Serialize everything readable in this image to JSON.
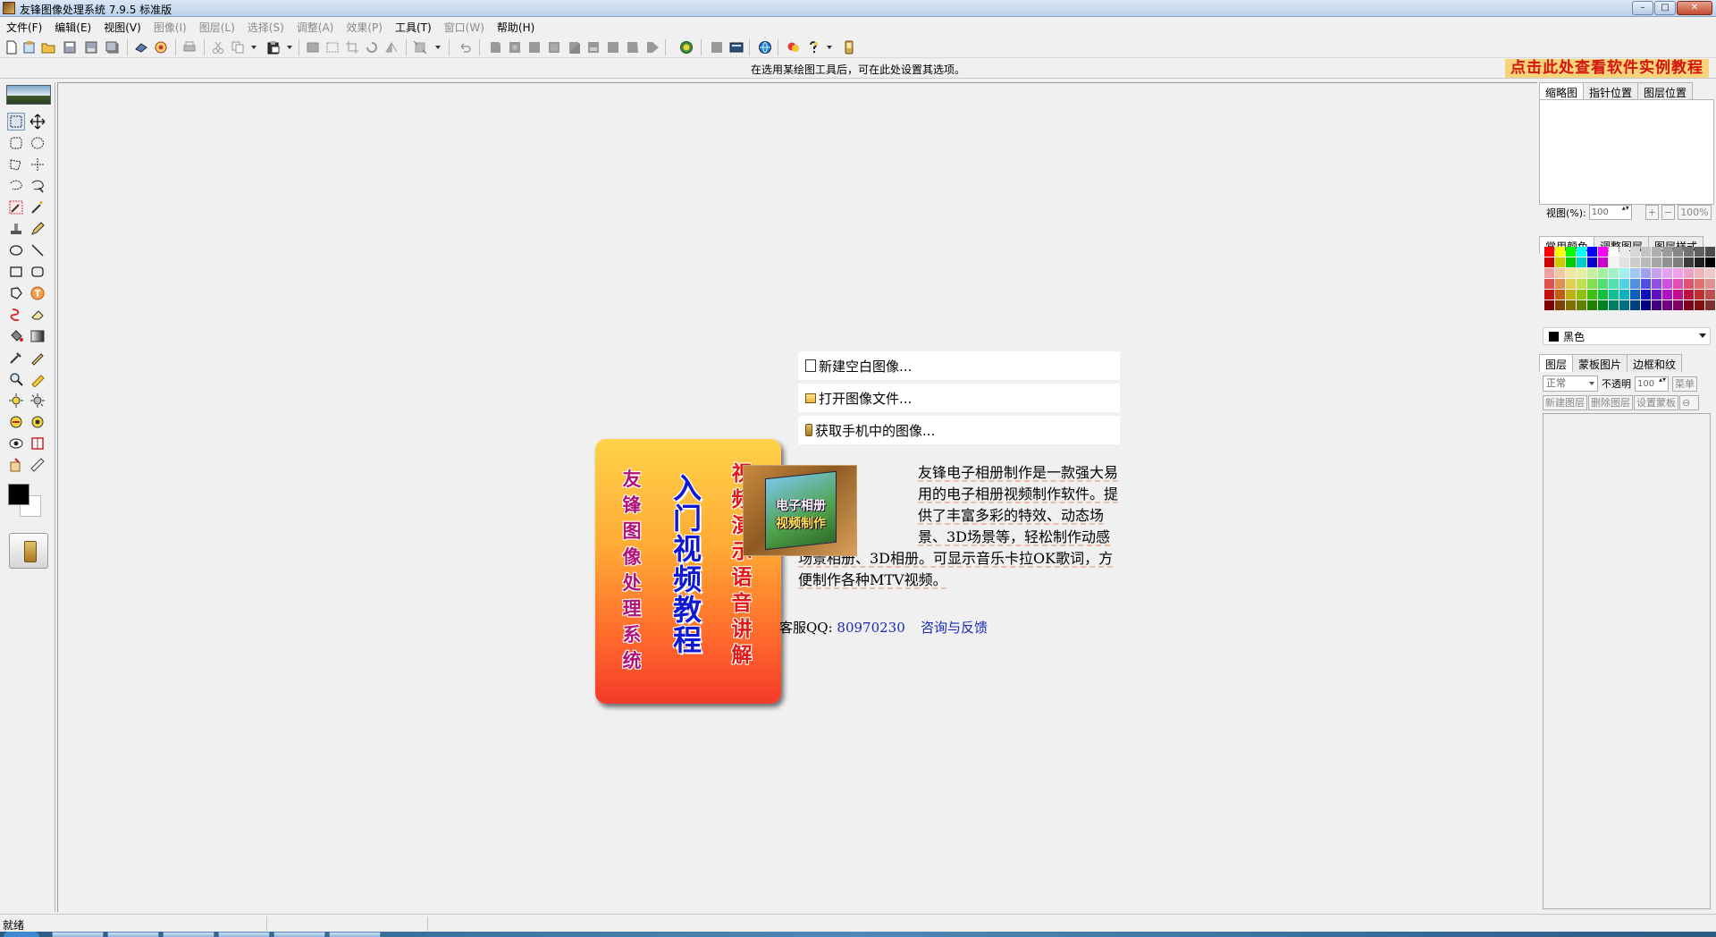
{
  "window": {
    "title": "友锋图像处理系统 7.9.5 标准版",
    "controls": {
      "minimize": "–",
      "maximize": "□",
      "close": "✕"
    }
  },
  "menu": [
    {
      "label": "文件(F)",
      "enabled": true
    },
    {
      "label": "编辑(E)",
      "enabled": true
    },
    {
      "label": "视图(V)",
      "enabled": true
    },
    {
      "label": "图像(I)",
      "enabled": false
    },
    {
      "label": "图层(L)",
      "enabled": false
    },
    {
      "label": "选择(S)",
      "enabled": false
    },
    {
      "label": "调整(A)",
      "enabled": false
    },
    {
      "label": "效果(P)",
      "enabled": false
    },
    {
      "label": "工具(T)",
      "enabled": true
    },
    {
      "label": "窗口(W)",
      "enabled": false
    },
    {
      "label": "帮助(H)",
      "enabled": true
    }
  ],
  "options_bar": {
    "hint": "在选用某绘图工具后，可在此处设置其选项。",
    "tutorial_banner": "点击此处查看软件实例教程"
  },
  "promo_card": {
    "col1": [
      "友",
      "锋",
      "图",
      "像",
      "处",
      "理",
      "系",
      "统"
    ],
    "col2": [
      "入",
      "门",
      "视",
      "频",
      "教",
      "程"
    ],
    "col3": [
      "视",
      "频",
      "演",
      "示",
      "语",
      "音",
      "讲",
      "解"
    ]
  },
  "start_actions": [
    {
      "label": "新建空白图像...",
      "icon": "new-document-icon"
    },
    {
      "label": "打开图像文件...",
      "icon": "open-folder-icon"
    },
    {
      "label": "获取手机中的图像...",
      "icon": "phone-icon"
    }
  ],
  "product": {
    "box_line1": "电子相册",
    "box_line2": "视频制作",
    "description": "友锋电子相册制作是一款强大易用的电子相册视频制作软件。提供了丰富多彩的特效、动态场景、3D场景等，轻松制作动感场景相册、3D相册。可显示音乐卡拉OK歌词，方便制作各种MTV视频。"
  },
  "contact": {
    "qq_label": "客服QQ: ",
    "qq_number": "80970230",
    "feedback": "咨询与反馈"
  },
  "panels": {
    "navigator": {
      "tabs": [
        "缩略图",
        "指针位置",
        "图层位置"
      ],
      "zoom_label": "视图(%):",
      "zoom_value": "100",
      "zoom_in": "+",
      "zoom_out": "−",
      "zoom_reset": "100%"
    },
    "colors": {
      "tabs": [
        "常用颜色",
        "调整图层",
        "图层样式"
      ],
      "selected_color_name": "黑色",
      "swatches": [
        "#ff0000",
        "#ffff00",
        "#00ff00",
        "#00ffff",
        "#0000ff",
        "#ff00ff",
        "#ffffff",
        "#ebebeb",
        "#d7d7d7",
        "#c3c3c3",
        "#afafaf",
        "#9b9b9b",
        "#878787",
        "#737373",
        "#5f5f5f",
        "#4b4b4b",
        "#cc0000",
        "#cccc00",
        "#00cc00",
        "#00cccc",
        "#0000cc",
        "#cc00cc",
        "#f5f5f5",
        "#e1e1e1",
        "#cdcdcd",
        "#b9b9b9",
        "#a5a5a5",
        "#919191",
        "#7d7d7d",
        "#3c3c3c",
        "#1e1e1e",
        "#000000",
        "#f0a0a0",
        "#f0c8a0",
        "#f0e6a0",
        "#e6f0a0",
        "#c8f0a0",
        "#a0f0a0",
        "#a0f0c8",
        "#a0f0f0",
        "#a0c8f0",
        "#a0a0f0",
        "#c8a0f0",
        "#e6a0f0",
        "#f0a0e6",
        "#f0a0c8",
        "#f0b4b4",
        "#f0c8c8",
        "#e05050",
        "#e09050",
        "#e0d050",
        "#c0e050",
        "#80e050",
        "#50e070",
        "#50e0b0",
        "#50d0e0",
        "#5090e0",
        "#5050e0",
        "#9050e0",
        "#d050e0",
        "#e050b0",
        "#e05070",
        "#e07070",
        "#e09090",
        "#c01010",
        "#c06010",
        "#c0b010",
        "#90c010",
        "#40c010",
        "#10c040",
        "#10c090",
        "#10b0c0",
        "#1060c0",
        "#1010c0",
        "#6010c0",
        "#b010c0",
        "#c01090",
        "#c01040",
        "#c03030",
        "#c05050",
        "#800000",
        "#804000",
        "#807000",
        "#608000",
        "#208000",
        "#008020",
        "#008060",
        "#007080",
        "#004080",
        "#000080",
        "#400080",
        "#700080",
        "#800060",
        "#800020",
        "#801010",
        "#803030"
      ]
    },
    "layers": {
      "tabs": [
        "图层",
        "蒙板图片",
        "边框和纹"
      ],
      "blend_mode": "正常",
      "opacity_label": "不透明",
      "opacity_value": "100",
      "menu_button": "菜单",
      "actions": [
        "新建图层",
        "删除图层",
        "设置蒙板"
      ]
    }
  },
  "status": {
    "text": "就绪"
  }
}
